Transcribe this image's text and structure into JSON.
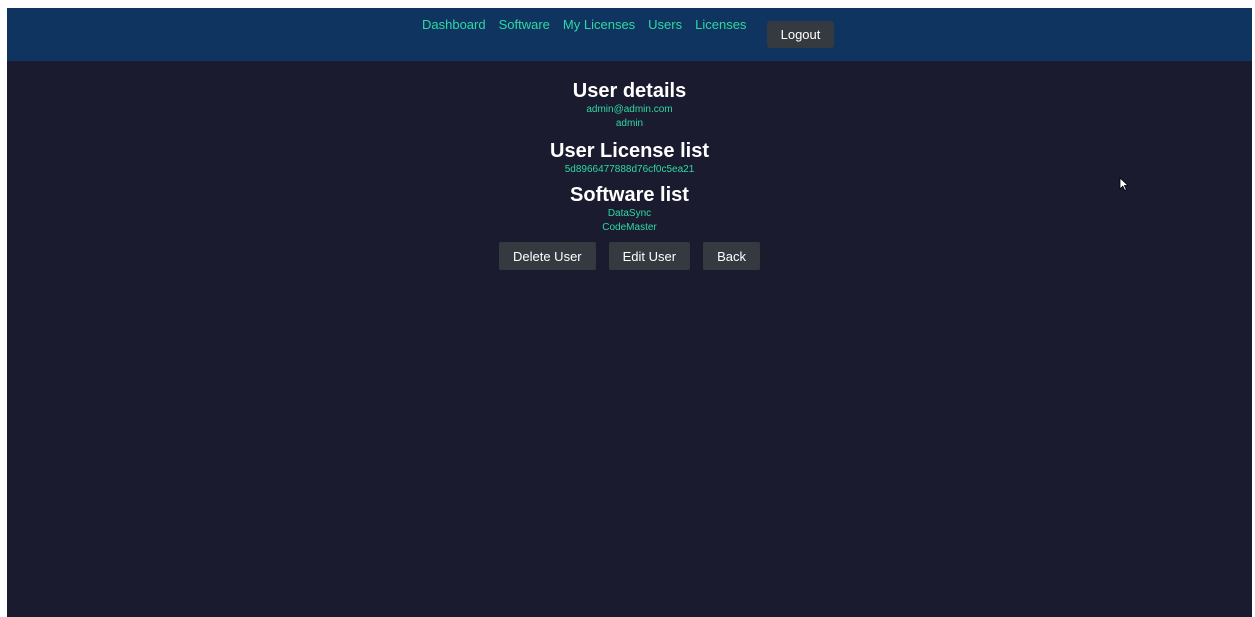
{
  "nav": {
    "links": [
      "Dashboard",
      "Software",
      "My Licenses",
      "Users",
      "Licenses"
    ],
    "logout_label": "Logout"
  },
  "user_details": {
    "heading": "User details",
    "email": "admin@admin.com",
    "role": "admin"
  },
  "license_list": {
    "heading": "User License list",
    "items": [
      "5d8966477888d76cf0c5ea21"
    ]
  },
  "software_list": {
    "heading": "Software list",
    "items": [
      "DataSync",
      "CodeMaster"
    ]
  },
  "actions": {
    "delete_label": "Delete User",
    "edit_label": "Edit User",
    "back_label": "Back"
  },
  "colors": {
    "page_bg": "#1a1b2e",
    "navbar_bg": "#0f3460",
    "link_accent": "#2ed9a3",
    "button_bg": "#343a40"
  },
  "icons": {
    "cursor": "mouse-pointer-icon"
  }
}
